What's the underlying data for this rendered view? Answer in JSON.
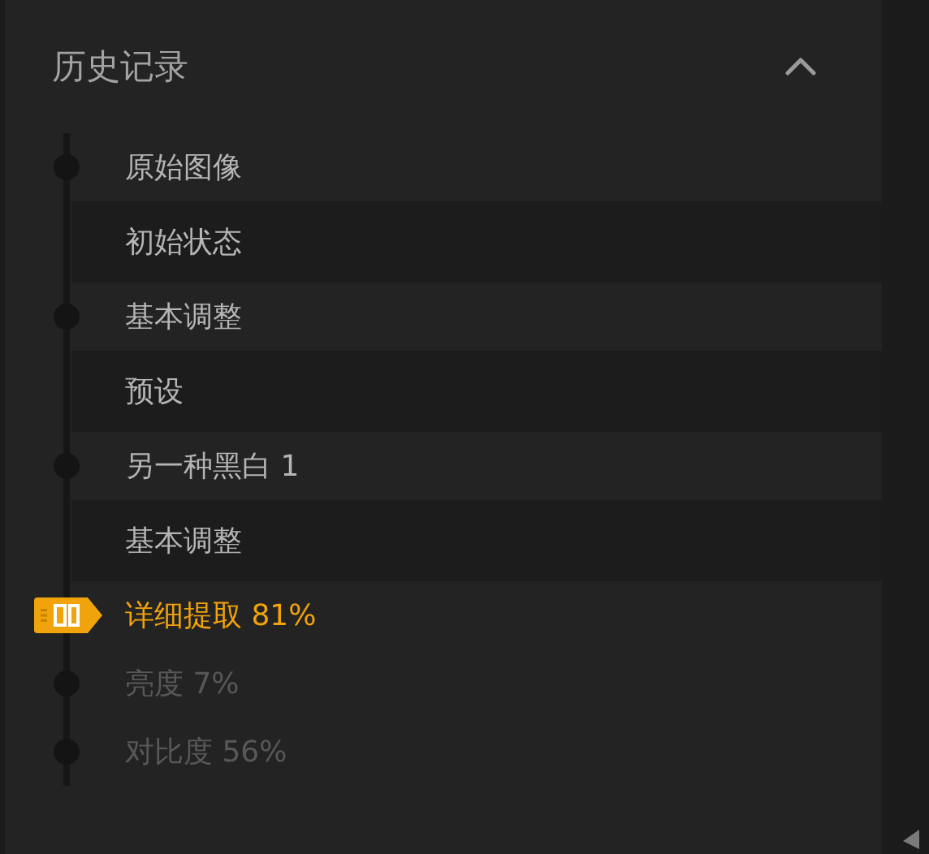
{
  "panel": {
    "title": "历史记录",
    "expanded": true
  },
  "history": [
    {
      "label": "原始图像",
      "kind": "step",
      "selected": false,
      "undone": false
    },
    {
      "label": "初始状态",
      "kind": "snapshot",
      "selected": false,
      "undone": false
    },
    {
      "label": "基本调整",
      "kind": "step",
      "selected": false,
      "undone": false
    },
    {
      "label": "预设",
      "kind": "snapshot",
      "selected": false,
      "undone": false
    },
    {
      "label": "另一种黑白 1",
      "kind": "step",
      "selected": false,
      "undone": false
    },
    {
      "label": "基本调整",
      "kind": "snapshot",
      "selected": false,
      "undone": false
    },
    {
      "label": "详细提取 81%",
      "kind": "step",
      "selected": true,
      "undone": false
    },
    {
      "label": "亮度 7%",
      "kind": "step",
      "selected": false,
      "undone": true
    },
    {
      "label": "对比度 56%",
      "kind": "step",
      "selected": false,
      "undone": true
    }
  ]
}
